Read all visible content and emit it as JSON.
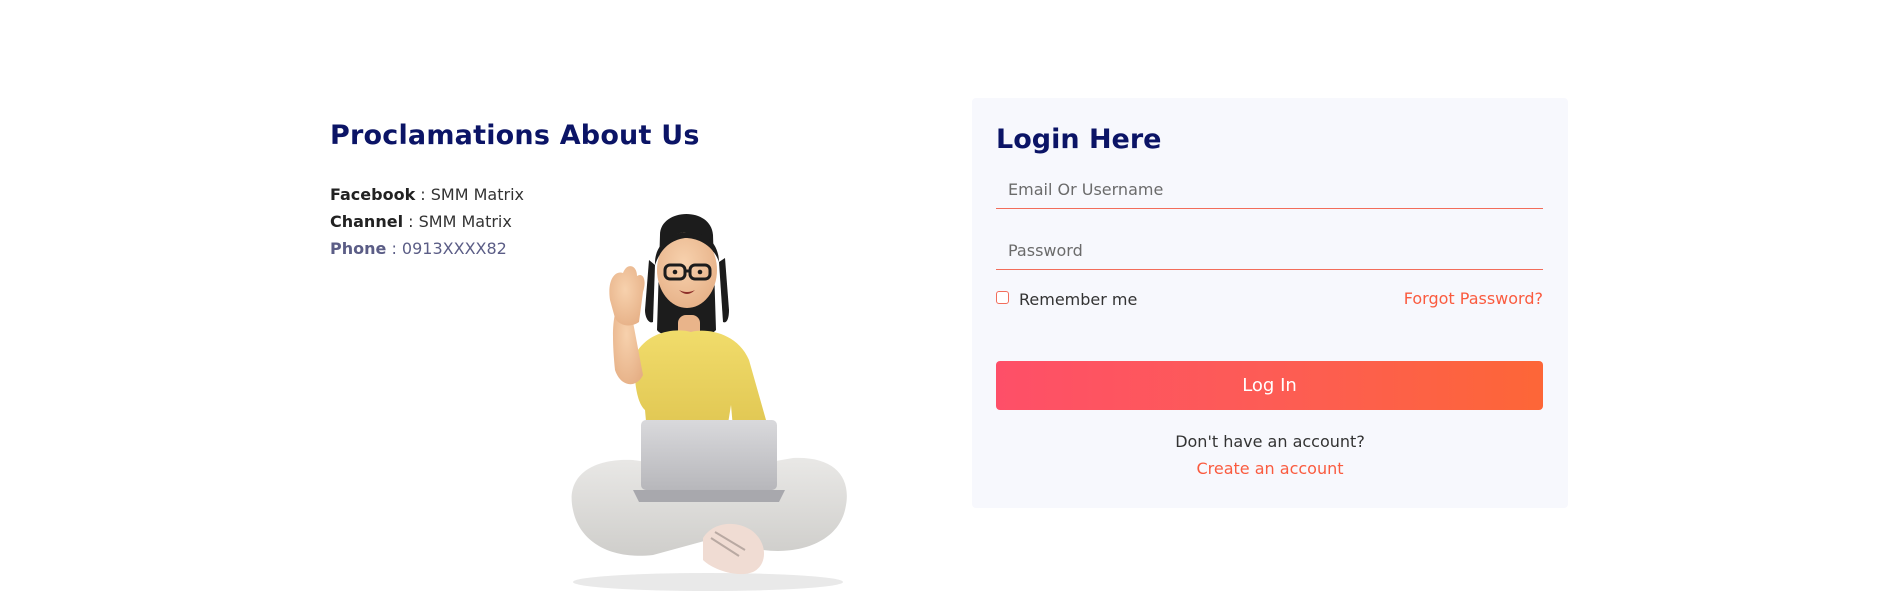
{
  "about": {
    "title": "Proclamations About Us",
    "facebook_key": "Facebook",
    "facebook_value": " : SMM Matrix",
    "channel_key": "Channel",
    "channel_value": " : SMM Matrix",
    "phone_key": "Phone",
    "phone_value": " :  0913XXXX82"
  },
  "illustration": {
    "icon": "girl-with-laptop-illustration"
  },
  "login": {
    "title": "Login Here",
    "email_placeholder": "Email Or Username",
    "password_placeholder": "Password",
    "remember_label": "Remember me",
    "forgot_label": "Forgot Password?",
    "submit_label": "Log In",
    "no_account_text": "Don't have an account?",
    "create_account_label": "Create an account"
  },
  "colors": {
    "heading": "#0b1466",
    "accent": "#fa5b3f",
    "button_start": "#fe4f68",
    "button_end": "#fd6637",
    "card_bg": "#f7f8fd"
  }
}
